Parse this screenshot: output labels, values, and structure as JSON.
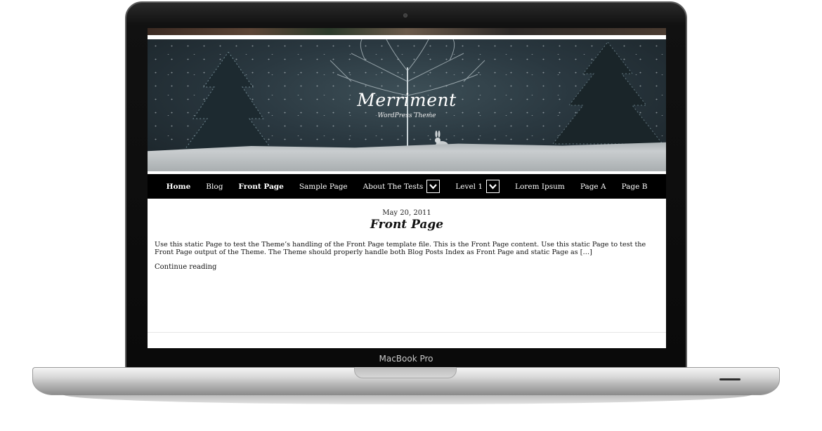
{
  "device": {
    "label": "MacBook Pro"
  },
  "site": {
    "title": "Merriment",
    "tagline": "WordPress Theme"
  },
  "nav": {
    "items": [
      {
        "label": "Home"
      },
      {
        "label": "Blog"
      },
      {
        "label": "Front Page"
      },
      {
        "label": "Sample Page"
      },
      {
        "label": "About The Tests"
      },
      {
        "label": "Level 1"
      },
      {
        "label": "Lorem Ipsum"
      },
      {
        "label": "Page A"
      },
      {
        "label": "Page B"
      }
    ]
  },
  "post": {
    "date": "May 20, 2011",
    "title": "Front Page",
    "excerpt": "Use this static Page to test the Theme’s handling of the Front Page template file. This is the Front Page content. Use this static Page to test the Front Page output of the Theme. The Theme should properly handle both Blog Posts Index as Front Page and static Page as […]",
    "continue_label": "Continue reading"
  },
  "icons": {
    "dropdown": "chevron-down-icon",
    "camera": "camera-dot"
  },
  "colors": {
    "nav_bg": "#000000",
    "page_bg": "#ffffff",
    "text": "#111111"
  }
}
